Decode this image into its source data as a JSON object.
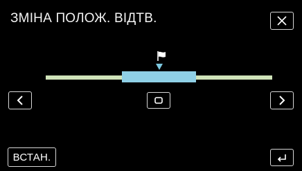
{
  "screen": {
    "title": "ЗМІНА ПОЛОЖ. ВІДТВ."
  },
  "buttons": {
    "close_icon": "close-x-icon",
    "prev_icon": "chevron-left-icon",
    "next_icon": "chevron-right-icon",
    "center_icon": "square-marker-icon",
    "set_label": "ВСТАН.",
    "back_icon": "return-arrow-icon"
  },
  "timeline": {
    "position_marker_icon": "flag-icon"
  },
  "colors": {
    "track": "#cfe3b9",
    "segment": "#8fd0e6",
    "marker": "#7cc8e0",
    "button_border": "#d8d8d8"
  }
}
